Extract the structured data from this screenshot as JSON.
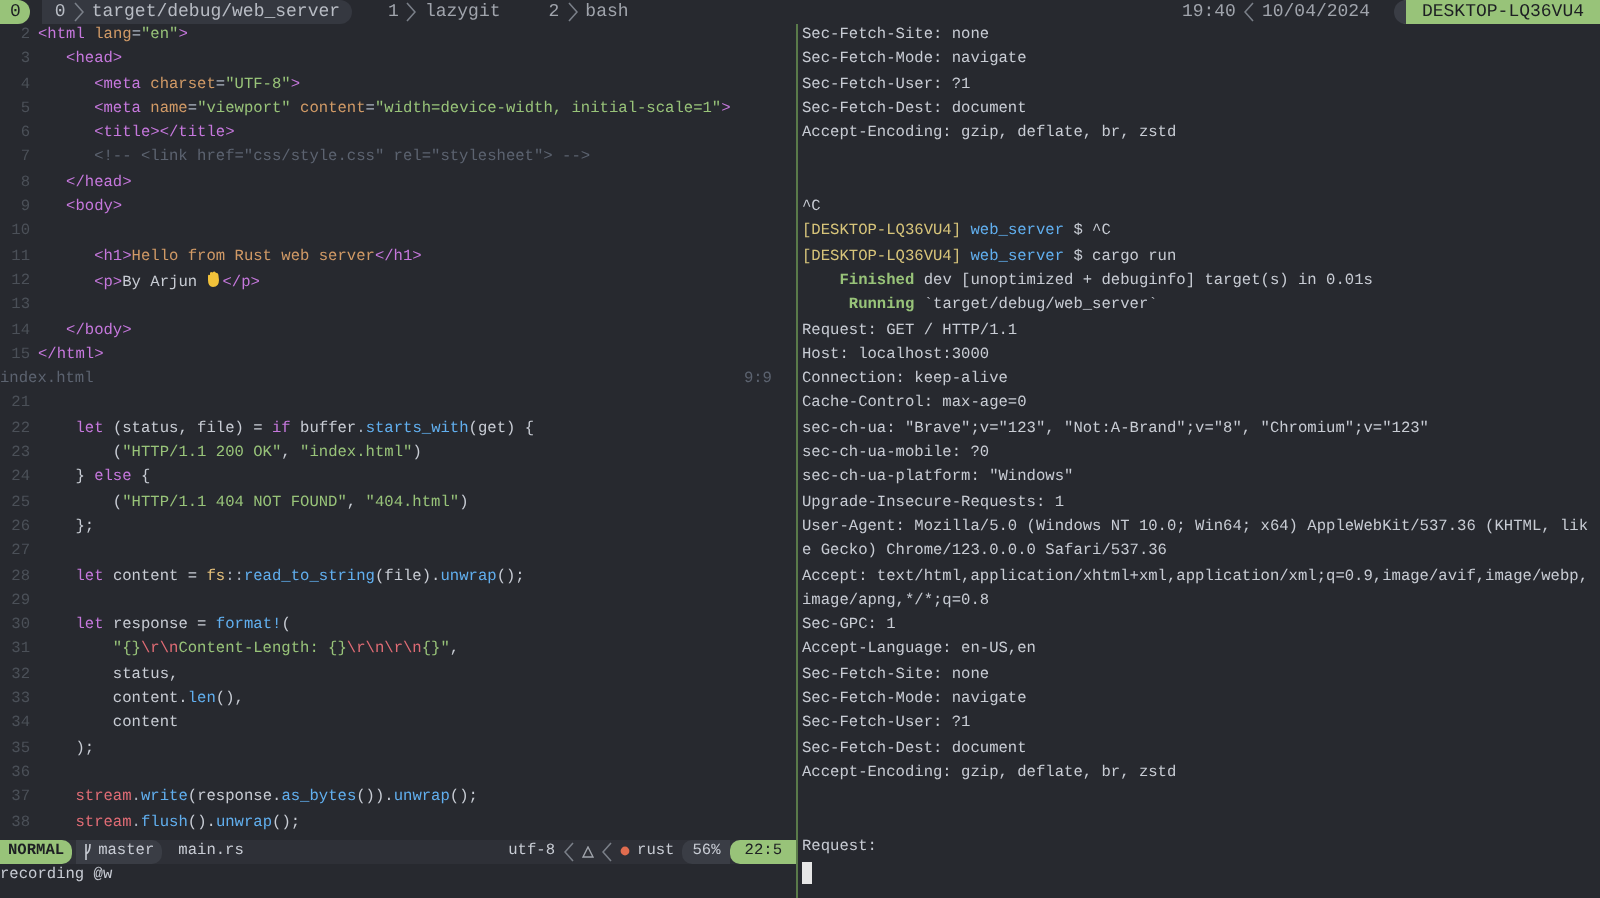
{
  "tmux": {
    "session": "0",
    "windows": [
      {
        "index": "0",
        "name": "target/debug/web_server",
        "selected": true
      },
      {
        "index": "1",
        "name": "lazygit",
        "selected": false
      },
      {
        "index": "2",
        "name": "bash",
        "selected": false
      }
    ],
    "time": "19:40",
    "date": "10/04/2024",
    "host": "DESKTOP-LQ36VU4"
  },
  "editor": {
    "top_pane": {
      "lines": [
        {
          "number": "2",
          "tokens": [
            {
              "text": "<html",
              "kind": "tag"
            },
            {
              "text": " lang",
              "kind": "attr"
            },
            {
              "text": "=",
              "kind": "punct"
            },
            {
              "text": "\"en\"",
              "kind": "string"
            },
            {
              "text": ">",
              "kind": "tag"
            }
          ]
        },
        {
          "number": "3",
          "tokens": [
            {
              "text": "   <head>",
              "kind": "tag"
            }
          ]
        },
        {
          "number": "4",
          "tokens": [
            {
              "text": "      <meta",
              "kind": "tag"
            },
            {
              "text": " charset",
              "kind": "attr"
            },
            {
              "text": "=",
              "kind": "punct"
            },
            {
              "text": "\"UTF-8\"",
              "kind": "string"
            },
            {
              "text": ">",
              "kind": "tag"
            }
          ]
        },
        {
          "number": "5",
          "tokens": [
            {
              "text": "      <meta",
              "kind": "tag"
            },
            {
              "text": " name",
              "kind": "attr"
            },
            {
              "text": "=",
              "kind": "punct"
            },
            {
              "text": "\"viewport\"",
              "kind": "string"
            },
            {
              "text": " content",
              "kind": "attr"
            },
            {
              "text": "=",
              "kind": "punct"
            },
            {
              "text": "\"width=device-width, initial-scale=1\"",
              "kind": "string"
            },
            {
              "text": ">",
              "kind": "tag"
            }
          ]
        },
        {
          "number": "6",
          "tokens": [
            {
              "text": "      <title></title>",
              "kind": "tag"
            }
          ]
        },
        {
          "number": "7",
          "tokens": [
            {
              "text": "      <!-- <link href=\"css/style.css\" rel=\"stylesheet\"> -->",
              "kind": "comment"
            }
          ]
        },
        {
          "number": "8",
          "tokens": [
            {
              "text": "   </head>",
              "kind": "tag"
            }
          ]
        },
        {
          "number": "9",
          "tokens": [
            {
              "text": "   <body>",
              "kind": "tag"
            }
          ]
        },
        {
          "number": "10"
        },
        {
          "number": "11",
          "tokens": [
            {
              "text": "      <h1>",
              "kind": "tag"
            },
            {
              "text": "Hello from Rust web server",
              "kind": "heading"
            },
            {
              "text": "</h1>",
              "kind": "tag"
            }
          ]
        },
        {
          "number": "12",
          "tokens": [
            {
              "text": "      <p>",
              "kind": "tag"
            },
            {
              "text": "By Arjun ",
              "kind": "text"
            },
            {
              "kind": "hand_icon"
            },
            {
              "text": "</p>",
              "kind": "tag"
            }
          ]
        },
        {
          "number": "13"
        },
        {
          "number": "14",
          "tokens": [
            {
              "text": "   </body>",
              "kind": "tag"
            }
          ]
        },
        {
          "number": "15",
          "tokens": [
            {
              "text": "</html>",
              "kind": "tag"
            }
          ]
        }
      ],
      "file_name": "index.html",
      "position": "9:9"
    },
    "bottom_pane": {
      "lines": [
        {
          "number": "21"
        },
        {
          "number": "22",
          "tokens": [
            {
              "text": "    let",
              "kind": "keyword"
            },
            {
              "text": " (status, file) = ",
              "kind": "text"
            },
            {
              "text": "if",
              "kind": "keyword"
            },
            {
              "text": " buffer",
              "kind": "text"
            },
            {
              "text": ".",
              "kind": "punct"
            },
            {
              "text": "starts_with",
              "kind": "func"
            },
            {
              "text": "(get) {",
              "kind": "text"
            }
          ]
        },
        {
          "number": "23",
          "tokens": [
            {
              "text": "        (",
              "kind": "text"
            },
            {
              "text": "\"HTTP/1.1 200 OK\"",
              "kind": "string"
            },
            {
              "text": ", ",
              "kind": "text"
            },
            {
              "text": "\"index.html\"",
              "kind": "string"
            },
            {
              "text": ")",
              "kind": "text"
            }
          ]
        },
        {
          "number": "24",
          "tokens": [
            {
              "text": "    } ",
              "kind": "text"
            },
            {
              "text": "else",
              "kind": "keyword"
            },
            {
              "text": " {",
              "kind": "text"
            }
          ]
        },
        {
          "number": "25",
          "tokens": [
            {
              "text": "        (",
              "kind": "text"
            },
            {
              "text": "\"HTTP/1.1 404 NOT FOUND\"",
              "kind": "string"
            },
            {
              "text": ", ",
              "kind": "text"
            },
            {
              "text": "\"404.html\"",
              "kind": "string"
            },
            {
              "text": ")",
              "kind": "text"
            }
          ]
        },
        {
          "number": "26",
          "tokens": [
            {
              "text": "    };",
              "kind": "text"
            }
          ]
        },
        {
          "number": "27"
        },
        {
          "number": "28",
          "tokens": [
            {
              "text": "    let",
              "kind": "keyword"
            },
            {
              "text": " content = ",
              "kind": "text"
            },
            {
              "text": "fs",
              "kind": "module"
            },
            {
              "text": "::",
              "kind": "punct"
            },
            {
              "text": "read_to_string",
              "kind": "func"
            },
            {
              "text": "(file).",
              "kind": "text"
            },
            {
              "text": "unwrap",
              "kind": "func"
            },
            {
              "text": "();",
              "kind": "text"
            }
          ]
        },
        {
          "number": "29"
        },
        {
          "number": "30",
          "tokens": [
            {
              "text": "    let",
              "kind": "keyword"
            },
            {
              "text": " response = ",
              "kind": "text"
            },
            {
              "text": "format!",
              "kind": "func"
            },
            {
              "text": "(",
              "kind": "text"
            }
          ]
        },
        {
          "number": "31",
          "tokens": [
            {
              "text": "        \"{}",
              "kind": "string"
            },
            {
              "text": "\\r\\n",
              "kind": "escape"
            },
            {
              "text": "Content-Length: {}",
              "kind": "string"
            },
            {
              "text": "\\r\\n\\r\\n",
              "kind": "escape"
            },
            {
              "text": "{}\"",
              "kind": "string"
            },
            {
              "text": ",",
              "kind": "text"
            }
          ]
        },
        {
          "number": "32",
          "tokens": [
            {
              "text": "        status,",
              "kind": "text"
            }
          ]
        },
        {
          "number": "33",
          "tokens": [
            {
              "text": "        content.",
              "kind": "text"
            },
            {
              "text": "len",
              "kind": "func"
            },
            {
              "text": "(),",
              "kind": "text"
            }
          ]
        },
        {
          "number": "34",
          "tokens": [
            {
              "text": "        content",
              "kind": "text"
            }
          ]
        },
        {
          "number": "35",
          "tokens": [
            {
              "text": "    );",
              "kind": "text"
            }
          ]
        },
        {
          "number": "36"
        },
        {
          "number": "37",
          "tokens": [
            {
              "text": "    stream",
              "kind": "var"
            },
            {
              "text": ".",
              "kind": "punct"
            },
            {
              "text": "write",
              "kind": "func"
            },
            {
              "text": "(response.",
              "kind": "text"
            },
            {
              "text": "as_bytes",
              "kind": "func"
            },
            {
              "text": "()).",
              "kind": "text"
            },
            {
              "text": "unwrap",
              "kind": "func"
            },
            {
              "text": "();",
              "kind": "text"
            }
          ]
        },
        {
          "number": "38",
          "tokens": [
            {
              "text": "    stream",
              "kind": "var"
            },
            {
              "text": ".",
              "kind": "punct"
            },
            {
              "text": "flush",
              "kind": "func"
            },
            {
              "text": "().",
              "kind": "text"
            },
            {
              "text": "unwrap",
              "kind": "func"
            },
            {
              "text": "();",
              "kind": "text"
            }
          ]
        }
      ]
    },
    "statusline": {
      "mode": "NORMAL",
      "branch": "master",
      "file_name": "main.rs",
      "encoding": "utf-8",
      "filetype": "rust",
      "percent": "56%",
      "position": "22:5"
    },
    "command_line": "recording @w"
  },
  "terminal": {
    "lines": [
      {
        "kind": "text",
        "tokens": [
          {
            "text": "Sec-Fetch-Site: none",
            "kind": "text"
          }
        ]
      },
      {
        "kind": "text",
        "tokens": [
          {
            "text": "Sec-Fetch-Mode: navigate",
            "kind": "text"
          }
        ]
      },
      {
        "kind": "text",
        "tokens": [
          {
            "text": "Sec-Fetch-User: ?1",
            "kind": "text"
          }
        ]
      },
      {
        "kind": "text",
        "tokens": [
          {
            "text": "Sec-Fetch-Dest: document",
            "kind": "text"
          }
        ]
      },
      {
        "kind": "text",
        "tokens": [
          {
            "text": "Accept-Encoding: gzip, deflate, br, zstd",
            "kind": "text"
          }
        ]
      },
      {
        "kind": "blank"
      },
      {
        "kind": "blank"
      },
      {
        "kind": "text",
        "tokens": [
          {
            "text": "^C",
            "kind": "text"
          }
        ]
      },
      {
        "kind": "text",
        "tokens": [
          {
            "text": "[DESKTOP-LQ36VU4]",
            "kind": "host"
          },
          {
            "text": " web_server",
            "kind": "dir"
          },
          {
            "text": " $ ^C",
            "kind": "text"
          }
        ]
      },
      {
        "kind": "text",
        "tokens": [
          {
            "text": "[DESKTOP-LQ36VU4]",
            "kind": "host"
          },
          {
            "text": " web_server",
            "kind": "dir"
          },
          {
            "text": " $ cargo run",
            "kind": "text"
          }
        ]
      },
      {
        "kind": "text",
        "tokens": [
          {
            "text": "    Finished",
            "kind": "success"
          },
          {
            "text": " dev [unoptimized + debuginfo] target(s) in 0.01s",
            "kind": "text"
          }
        ]
      },
      {
        "kind": "text",
        "tokens": [
          {
            "text": "     Running",
            "kind": "success"
          },
          {
            "text": " `target/debug/web_server`",
            "kind": "text"
          }
        ]
      },
      {
        "kind": "text",
        "tokens": [
          {
            "text": "Request: GET / HTTP/1.1",
            "kind": "text"
          }
        ]
      },
      {
        "kind": "text",
        "tokens": [
          {
            "text": "Host: localhost:3000",
            "kind": "text"
          }
        ]
      },
      {
        "kind": "text",
        "tokens": [
          {
            "text": "Connection: keep-alive",
            "kind": "text"
          }
        ]
      },
      {
        "kind": "text",
        "tokens": [
          {
            "text": "Cache-Control: max-age=0",
            "kind": "text"
          }
        ]
      },
      {
        "kind": "text",
        "tokens": [
          {
            "text": "sec-ch-ua: \"Brave\";v=\"123\", \"Not:A-Brand\";v=\"8\", \"Chromium\";v=\"123\"",
            "kind": "text"
          }
        ]
      },
      {
        "kind": "text",
        "tokens": [
          {
            "text": "sec-ch-ua-mobile: ?0",
            "kind": "text"
          }
        ]
      },
      {
        "kind": "text",
        "tokens": [
          {
            "text": "sec-ch-ua-platform: \"Windows\"",
            "kind": "text"
          }
        ]
      },
      {
        "kind": "text",
        "tokens": [
          {
            "text": "Upgrade-Insecure-Requests: 1",
            "kind": "text"
          }
        ]
      },
      {
        "kind": "text",
        "tokens": [
          {
            "text": "User-Agent: Mozilla/5.0 (Windows NT 10.0; Win64; x64) AppleWebKit/537.36 (KHTML, lik",
            "kind": "text"
          }
        ]
      },
      {
        "kind": "text",
        "tokens": [
          {
            "text": "e Gecko) Chrome/123.0.0.0 Safari/537.36",
            "kind": "text"
          }
        ]
      },
      {
        "kind": "text",
        "tokens": [
          {
            "text": "Accept: text/html,application/xhtml+xml,application/xml;q=0.9,image/avif,image/webp,",
            "kind": "text"
          }
        ]
      },
      {
        "kind": "text",
        "tokens": [
          {
            "text": "image/apng,*/*;q=0.8",
            "kind": "text"
          }
        ]
      },
      {
        "kind": "text",
        "tokens": [
          {
            "text": "Sec-GPC: 1",
            "kind": "text"
          }
        ]
      },
      {
        "kind": "text",
        "tokens": [
          {
            "text": "Accept-Language: en-US,en",
            "kind": "text"
          }
        ]
      },
      {
        "kind": "text",
        "tokens": [
          {
            "text": "Sec-Fetch-Site: none",
            "kind": "text"
          }
        ]
      },
      {
        "kind": "text",
        "tokens": [
          {
            "text": "Sec-Fetch-Mode: navigate",
            "kind": "text"
          }
        ]
      },
      {
        "kind": "text",
        "tokens": [
          {
            "text": "Sec-Fetch-User: ?1",
            "kind": "text"
          }
        ]
      },
      {
        "kind": "text",
        "tokens": [
          {
            "text": "Sec-Fetch-Dest: document",
            "kind": "text"
          }
        ]
      },
      {
        "kind": "text",
        "tokens": [
          {
            "text": "Accept-Encoding: gzip, deflate, br, zstd",
            "kind": "text"
          }
        ]
      },
      {
        "kind": "blank"
      },
      {
        "kind": "blank"
      },
      {
        "kind": "text",
        "tokens": [
          {
            "text": "Request:",
            "kind": "text"
          }
        ]
      },
      {
        "kind": "cursor"
      }
    ]
  }
}
